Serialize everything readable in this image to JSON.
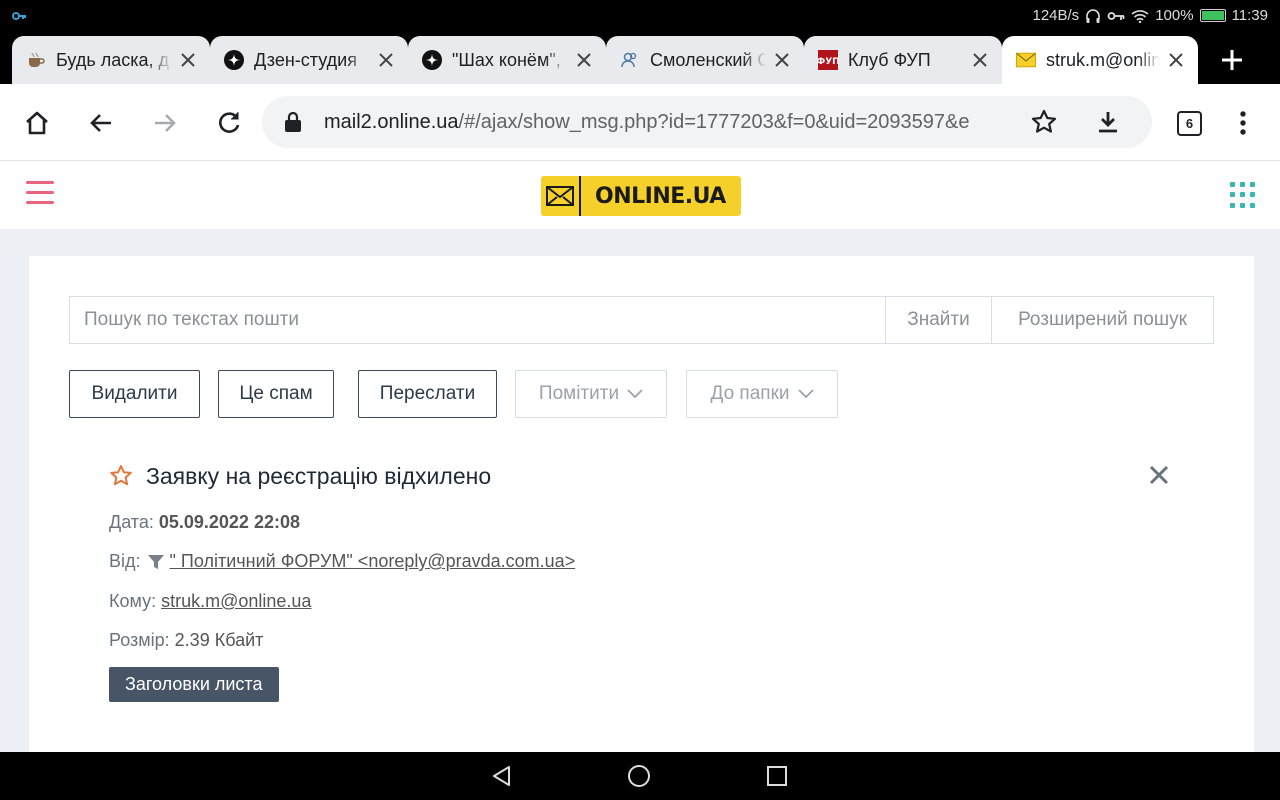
{
  "status_bar": {
    "net_speed": "124B/s",
    "battery": "100%",
    "battery_level": 1.0,
    "time": "11:39",
    "icons": [
      "key-icon",
      "headphones-icon",
      "vpn-key-icon",
      "wifi-icon",
      "battery-icon"
    ]
  },
  "tabs": [
    {
      "title": "Будь ласка, д",
      "favicon": "cup-icon"
    },
    {
      "title": "Дзен-студия",
      "favicon": "zen-icon"
    },
    {
      "title": "\"Шах конём\", ",
      "favicon": "zen-icon"
    },
    {
      "title": "Смоленский С",
      "favicon": "people-icon"
    },
    {
      "title": "Клуб ФУП",
      "favicon": "fup-icon",
      "favicon_text": "ФУП"
    },
    {
      "title": "struk.m@onlin",
      "favicon": "mail-icon",
      "active": true
    }
  ],
  "toolbar": {
    "url_host": "mail2.online.ua",
    "url_path": "/#/ajax/show_msg.php?id=1777203&f=0&uid=2093597&e",
    "tab_count": "6"
  },
  "site": {
    "logo_text": "ONLINE.UA",
    "accent": "#e9637f",
    "logo_bg": "#f6d02a",
    "apps_color": "#39b6b2"
  },
  "search": {
    "placeholder": "Пошук по текстах пошти",
    "value": "",
    "find_label": "Знайти",
    "advanced_label": "Розширений пошук"
  },
  "actions": {
    "delete": "Видалити",
    "spam": "Це спам",
    "forward": "Переслати",
    "mark": "Помітити",
    "to_folder": "До папки"
  },
  "message": {
    "subject": "Заявку на реєстрацію відхилено",
    "date_label": "Дата:",
    "date": "05.09.2022 22:08",
    "from_label": "Від:",
    "from": "\" Політичний ФОРУМ\" <noreply@pravda.com.ua>",
    "to_label": "Кому:",
    "to": "struk.m@online.ua",
    "size_label": "Розмір:",
    "size": "2.39 Кбайт",
    "headers_button": "Заголовки листа"
  }
}
